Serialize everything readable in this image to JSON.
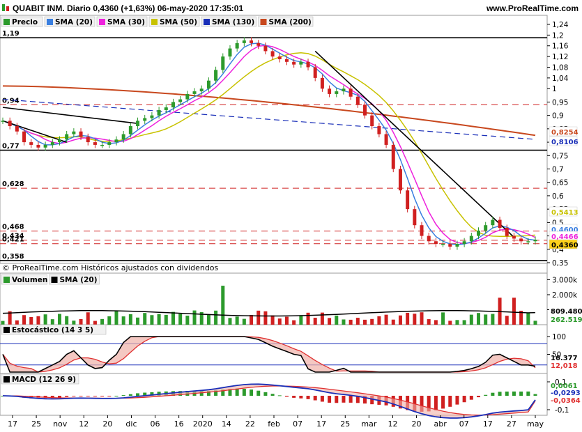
{
  "header": {
    "title": "QUABIT INM. Diario 0,4360 (+1,63%) 06-may-2020 17:35:01",
    "site": "www.ProRealTime.com"
  },
  "price_panel": {
    "legend": [
      {
        "label": "Precio",
        "color": "#2c9a2c",
        "icon": "candlestick-icon"
      },
      {
        "label": "SMA (20)",
        "color": "#3a7fe0"
      },
      {
        "label": "SMA (30)",
        "color": "#ee22dd"
      },
      {
        "label": "SMA (50)",
        "color": "#c8c200"
      },
      {
        "label": "SMA (130)",
        "color": "#1a2fb8"
      },
      {
        "label": "SMA (200)",
        "color": "#c8481e"
      }
    ],
    "axis_ticks": [
      "1,24",
      "1,2",
      "1,16",
      "1,12",
      "1,08",
      "1,04",
      "1",
      "0,95",
      "0,9",
      "0,85",
      "0,8",
      "0,75",
      "0,7",
      "0,65",
      "0,6",
      "0,55",
      "0,5",
      "0,45",
      "0,4",
      "0,35"
    ],
    "level_labels": [
      "1,19",
      "0,94",
      "0,77",
      "0,628",
      "0,468",
      "0,434",
      "0,421",
      "0,358"
    ],
    "value_tags": [
      {
        "text": "0,8254",
        "color": "#c8481e"
      },
      {
        "text": "0,8106",
        "color": "#1a2fb8"
      },
      {
        "text": "0,5413",
        "color": "#c8c200"
      },
      {
        "text": "0,4600",
        "color": "#3a7fe0"
      },
      {
        "text": "0,4466",
        "color": "#ee22dd"
      },
      {
        "text": "0,4360",
        "color": "#000000"
      }
    ],
    "footnote": "© ProRealTime.com Históricos ajustados con dividendos"
  },
  "volume_panel": {
    "legend": [
      {
        "label": "Volumen",
        "color": "#2c9a2c"
      },
      {
        "label": "SMA (20)",
        "color": "#000000"
      }
    ],
    "axis_ticks": [
      "3.000k",
      "2.000k",
      "1.000k"
    ],
    "value_tags": [
      {
        "text": "809.480",
        "color": "#000000"
      },
      {
        "text": "262.519",
        "color": "#2c9a2c"
      }
    ]
  },
  "stoch_panel": {
    "legend": [
      {
        "label": "Estocástico (14 3 5)",
        "color": "#000000"
      }
    ],
    "axis_ticks": [
      "100",
      "50"
    ],
    "value_tags": [
      {
        "text": "16.377",
        "color": "#000000"
      },
      {
        "text": "12,018",
        "color": "#e03030"
      }
    ]
  },
  "macd_panel": {
    "legend": [
      {
        "label": "MACD (12 26 9)",
        "color": "#000000"
      }
    ],
    "axis_ticks": [
      "0,1",
      "-0,1"
    ],
    "value_tags": [
      {
        "text": "0,0061",
        "color": "#2c9a2c"
      },
      {
        "text": "-0,0293",
        "color": "#1a2fb8"
      },
      {
        "text": "-0,0364",
        "color": "#e03030"
      }
    ]
  },
  "x_axis": [
    "17",
    "25",
    "nov",
    "12",
    "20",
    "dic",
    "06",
    "16",
    "2020",
    "14",
    "22",
    "feb",
    "07",
    "17",
    "25",
    "mar",
    "12",
    "20",
    "abr",
    "07",
    "17",
    "27",
    "may"
  ],
  "chart_data": {
    "type": "line",
    "instrument": "QUABIT INM.",
    "period": "Diario",
    "last": {
      "close": 0.436,
      "change_pct": 1.63,
      "date": "06-may-2020 17:35:01"
    },
    "ylim": [
      0.34,
      1.25
    ],
    "close_series": [
      0.88,
      0.86,
      0.84,
      0.8,
      0.79,
      0.78,
      0.79,
      0.8,
      0.81,
      0.83,
      0.84,
      0.82,
      0.8,
      0.79,
      0.79,
      0.8,
      0.81,
      0.83,
      0.86,
      0.88,
      0.89,
      0.9,
      0.92,
      0.93,
      0.95,
      0.96,
      0.98,
      0.99,
      1.0,
      1.03,
      1.07,
      1.12,
      1.15,
      1.17,
      1.18,
      1.17,
      1.16,
      1.14,
      1.12,
      1.11,
      1.1,
      1.09,
      1.1,
      1.08,
      1.04,
      1.0,
      0.98,
      0.99,
      1.0,
      0.97,
      0.94,
      0.9,
      0.86,
      0.83,
      0.79,
      0.7,
      0.62,
      0.55,
      0.49,
      0.45,
      0.43,
      0.42,
      0.42,
      0.41,
      0.42,
      0.43,
      0.45,
      0.47,
      0.49,
      0.51,
      0.48,
      0.45,
      0.44,
      0.43,
      0.43,
      0.436
    ],
    "horizontal_levels": [
      1.19,
      0.94,
      0.77,
      0.628,
      0.468,
      0.434,
      0.421,
      0.358
    ],
    "sma_last": {
      "SMA (20)": 0.46,
      "SMA (30)": 0.4466,
      "SMA (50)": 0.5413,
      "SMA (130)": 0.8106,
      "SMA (200)": 0.8254
    },
    "volume": {
      "last": 262519,
      "sma20_last": 809480,
      "ylim_k": [
        0,
        3000
      ]
    },
    "stochastic": {
      "k_last": 16.377,
      "d_last": 12.018,
      "ylim": [
        0,
        100
      ]
    },
    "macd": {
      "histogram_last": 0.0061,
      "macd_last": -0.0293,
      "signal_last": -0.0364
    }
  }
}
